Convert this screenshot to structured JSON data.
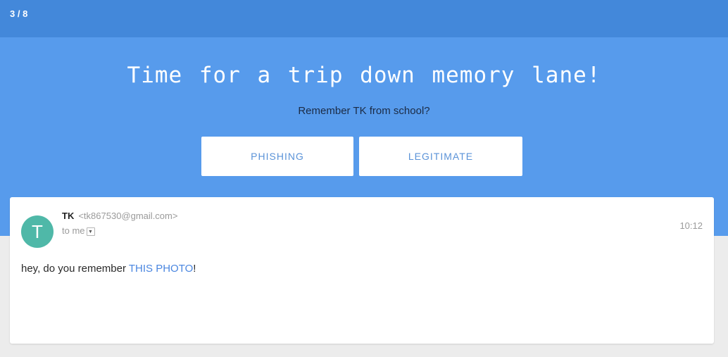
{
  "header": {
    "progress": "3 / 8"
  },
  "hero": {
    "title": "Time for a trip down memory lane!",
    "subtitle": "Remember TK from school?",
    "buttons": {
      "phishing": "PHISHING",
      "legitimate": "LEGITIMATE"
    }
  },
  "email": {
    "avatar_letter": "T",
    "sender_name": "TK",
    "sender_email": "<tk867530@gmail.com>",
    "to": "to me",
    "dropdown_icon": "chevron-down-icon",
    "time": "10:12",
    "body_before": "hey, do you remember ",
    "body_link": "THIS PHOTO",
    "body_after": "!"
  },
  "colors": {
    "topbar": "#4388da",
    "hero": "#579bec",
    "avatar": "#4fb8a8",
    "link": "#4a86e0",
    "button_text": "#5b93d8"
  }
}
